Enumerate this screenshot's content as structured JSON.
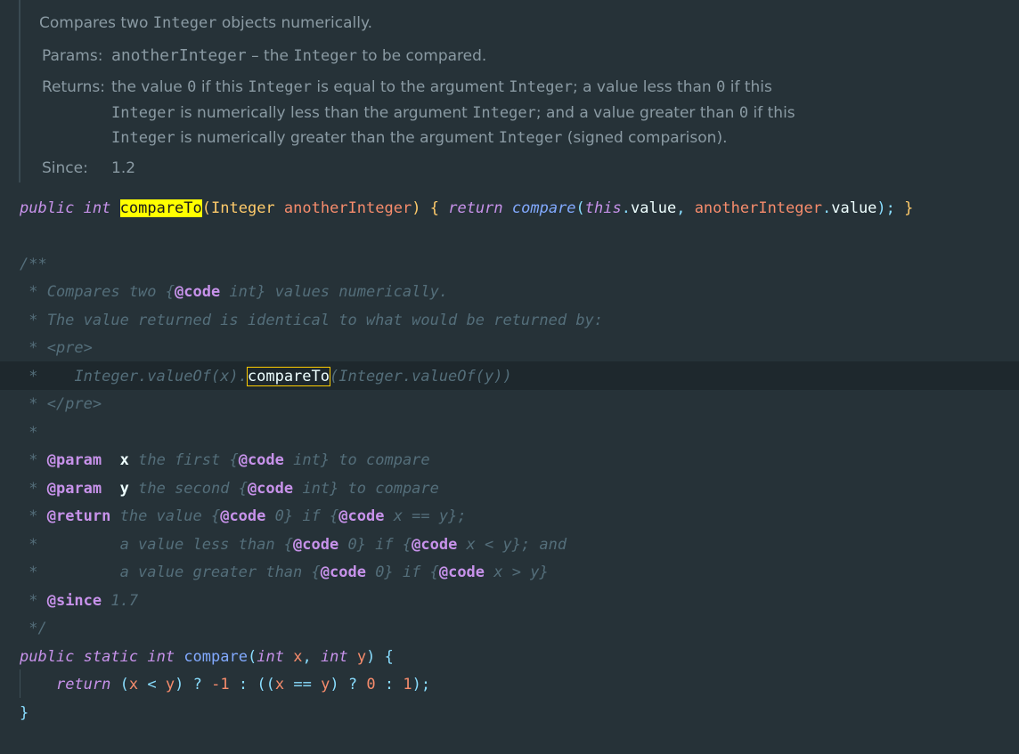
{
  "javadoc_popup": {
    "summary_text": "Compares two",
    "summary_code": "Integer",
    "summary_rest": "objects numerically.",
    "params_label": "Params:",
    "param_name": "anotherInteger",
    "param_dash": "–",
    "param_text1": "the",
    "param_code": "Integer",
    "param_text2": "to be compared.",
    "returns_label": "Returns:",
    "returns_l1_a": "the value",
    "returns_l1_code0": "0",
    "returns_l1_b": "if this",
    "returns_l1_code1": "Integer",
    "returns_l1_c": "is equal to the argument",
    "returns_l1_code2": "Integer",
    "returns_l1_d": "; a value less than",
    "returns_l1_code3": "0",
    "returns_l1_e": "if this",
    "returns_l2_code0": "Integer",
    "returns_l2_a": "is numerically less than the argument",
    "returns_l2_code1": "Integer",
    "returns_l2_b": "; and a value greater than",
    "returns_l2_code2": "0",
    "returns_l2_c": "if this",
    "returns_l3_code0": "Integer",
    "returns_l3_a": "is numerically greater than the argument",
    "returns_l3_code1": "Integer",
    "returns_l3_b": "(signed comparison).",
    "since_label": "Since:",
    "since_value": "1.2"
  },
  "code": {
    "l1": {
      "kw1": "public",
      "kw2": "int",
      "method": "compareTo",
      "p1": "(",
      "type": "Integer",
      "param": "anotherInteger",
      "p2": ")",
      "b1": "{",
      "ret": "return",
      "call": "compare",
      "p3": "(",
      "this": "this",
      "dot1": ".",
      "val1": "value",
      "comma": ",",
      "arg": "anotherInteger",
      "dot2": ".",
      "val2": "value",
      "p4": ");",
      "b2": "}"
    },
    "c_open": "/**",
    "c1_a": " * Compares two {",
    "c1_tag": "@code",
    "c1_b": " int} values numerically.",
    "c2": " * The value returned is identical to what would be returned by:",
    "c3": " * <pre>",
    "c4_a": " *    Integer.valueOf(x).",
    "c4_hl": "compareTo",
    "c4_b": "(Integer.valueOf(y))",
    "c5": " * </pre>",
    "c6": " *",
    "c7_a": " * ",
    "c7_tag": "@param",
    "c7_name": "x",
    "c7_b": " the first {",
    "c7_code": "@code",
    "c7_c": " int} to compare",
    "c8_a": " * ",
    "c8_tag": "@param",
    "c8_name": "y",
    "c8_b": " the second {",
    "c8_code": "@code",
    "c8_c": " int} to compare",
    "c9_a": " * ",
    "c9_tag": "@return",
    "c9_b": " the value {",
    "c9_code1": "@code",
    "c9_c": " 0} if {",
    "c9_code2": "@code",
    "c9_d": " x == y};",
    "c10_a": " *         a value less than {",
    "c10_code1": "@code",
    "c10_b": " 0} if {",
    "c10_code2": "@code",
    "c10_c": " x < y}; and",
    "c11_a": " *         a value greater than {",
    "c11_code1": "@code",
    "c11_b": " 0} if {",
    "c11_code2": "@code",
    "c11_c": " x > y}",
    "c12_a": " * ",
    "c12_tag": "@since",
    "c12_b": " 1.7",
    "c_close": " */",
    "l2": {
      "kw1": "public",
      "kw2": "static",
      "kw3": "int",
      "method": "compare",
      "p1": "(",
      "t1": "int",
      "x": "x",
      "comma": ",",
      "t2": "int",
      "y": "y",
      "p2": ")",
      "b1": "{"
    },
    "l3": {
      "ret": "return",
      "p1": "(",
      "x": "x",
      "lt": "<",
      "y": "y",
      "p2": ")",
      "q": "?",
      "n1": "-1",
      "colon1": ":",
      "p3": "((",
      "x2": "x",
      "eq": "==",
      "y2": "y",
      "p4": ")",
      "q2": "?",
      "n0": "0",
      "colon2": ":",
      "n2": "1",
      "p5": ");"
    },
    "l4": "}"
  }
}
